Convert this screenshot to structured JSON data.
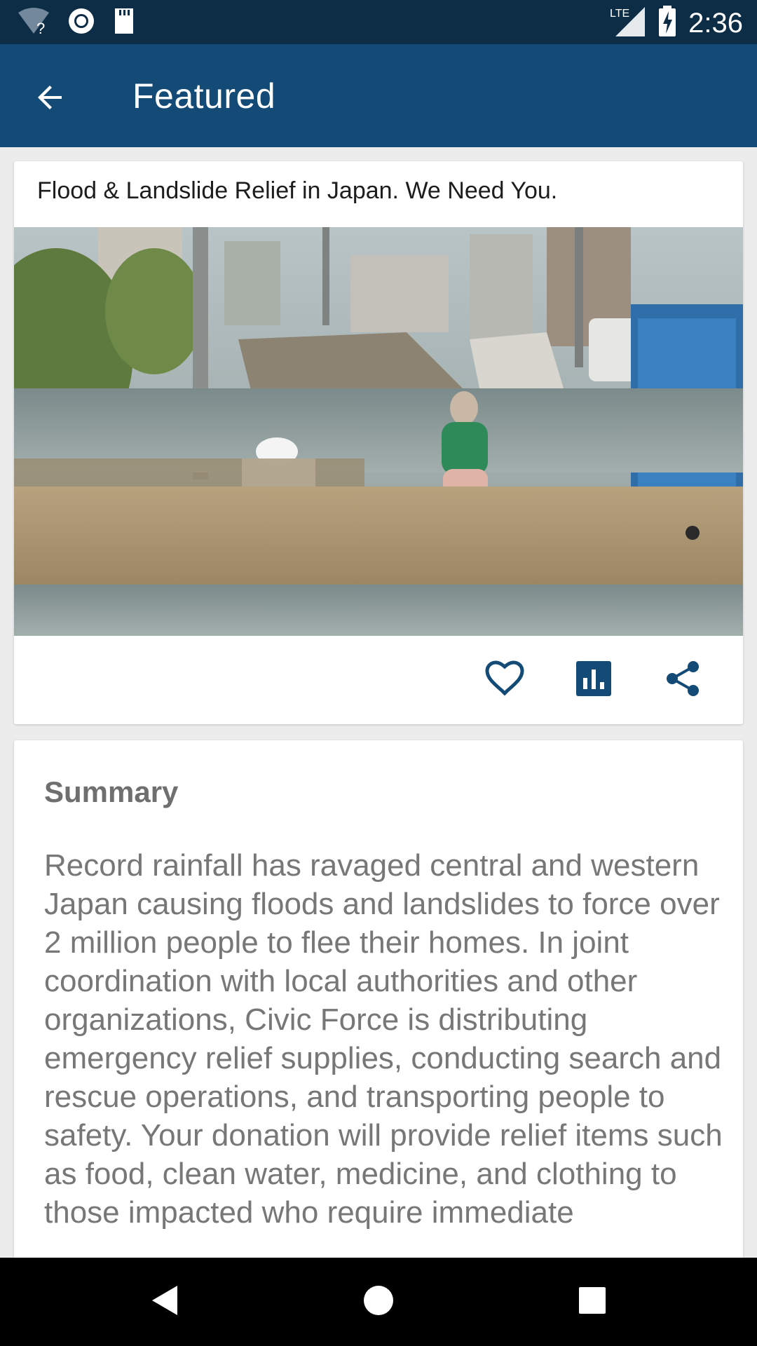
{
  "status_bar": {
    "time": "2:36",
    "network_label": "LTE",
    "icons": [
      "wifi-question-icon",
      "circle-icon",
      "sd-card-icon",
      "signal-icon",
      "battery-charging-icon"
    ]
  },
  "app_bar": {
    "title": "Featured",
    "back_icon": "arrow-back-icon"
  },
  "featured_card": {
    "title": "Flood & Landslide Relief in Japan. We Need You.",
    "image_description_icon": "flood-photo",
    "actions": [
      "heart-icon",
      "bar-chart-icon",
      "share-icon"
    ]
  },
  "summary_card": {
    "heading": "Summary",
    "body": "Record rainfall has ravaged central and western Japan causing floods and landslides to force over 2 million people to flee their homes. In joint coordination with local authorities and other organizations, Civic Force is distributing emergency relief supplies, conducting search and rescue operations, and transporting people to safety. Your donation will provide relief items such as food, clean water, medicine, and clothing to those impacted who require immediate"
  },
  "nav_bar": {
    "buttons": [
      "back-triangle-icon",
      "home-circle-icon",
      "recents-square-icon"
    ]
  },
  "colors": {
    "status_bar": "#0d2d47",
    "app_bar": "#134a76",
    "icon_accent": "#134a76",
    "background": "#ececec"
  }
}
